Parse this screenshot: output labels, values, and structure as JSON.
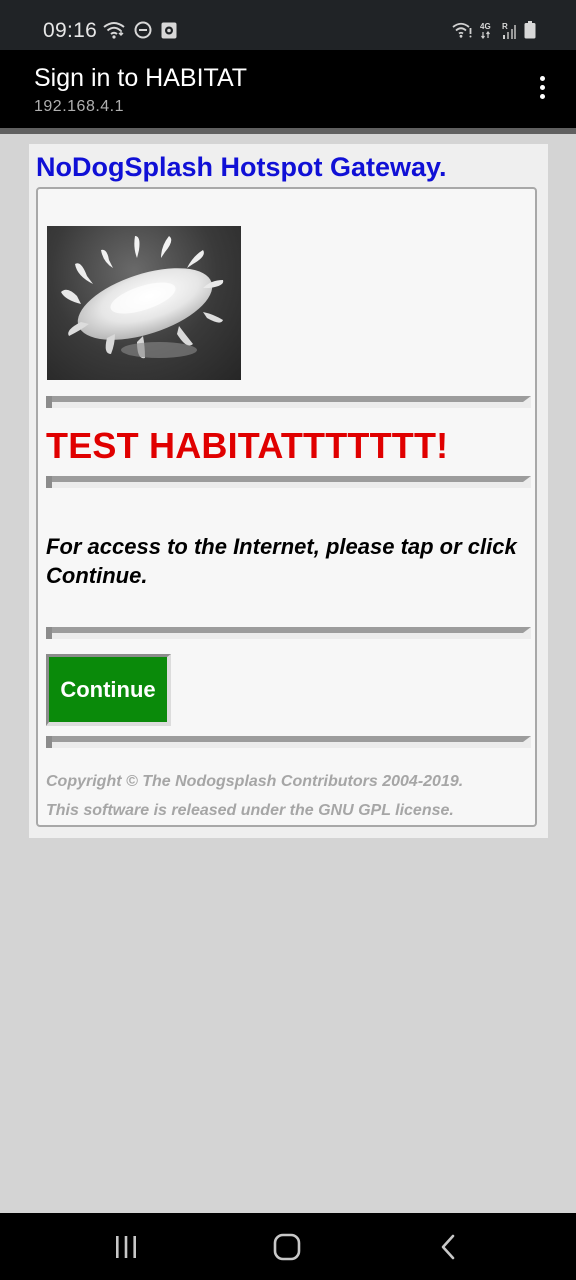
{
  "status_bar": {
    "time": "09:16",
    "left_icons": [
      "wifi-icon",
      "do-not-disturb-icon",
      "screen-record-icon"
    ],
    "network_label_top": "4G",
    "network_label_second": "R",
    "right_icons": [
      "wifi-alert-icon",
      "cell-signal-icon",
      "battery-icon"
    ]
  },
  "app_bar": {
    "title": "Sign in to HABITAT",
    "subtitle": "192.168.4.1",
    "menu_icon": "overflow-menu-icon"
  },
  "page": {
    "gateway_name": "NoDogSplash Hotspot Gateway.",
    "image_description_icon": "milk-splash-image",
    "headline": "TEST HABITATTTTTTT!",
    "access_text": "For access to the Internet, please tap or click Continue.",
    "continue_label": "Continue",
    "copyright_line1": "Copyright © The Nodogsplash Contributors 2004-2019.",
    "copyright_line2": "This software is released under the GNU GPL license."
  },
  "nav_bar": {
    "recents_icon": "recents-icon",
    "home_icon": "home-icon",
    "back_icon": "back-icon"
  },
  "colors": {
    "gateway_name": "#1010d6",
    "headline": "#e00000",
    "continue_button": "#0a8a0a",
    "copyright": "#a6a6a6",
    "page_background": "#d4d4d4"
  }
}
